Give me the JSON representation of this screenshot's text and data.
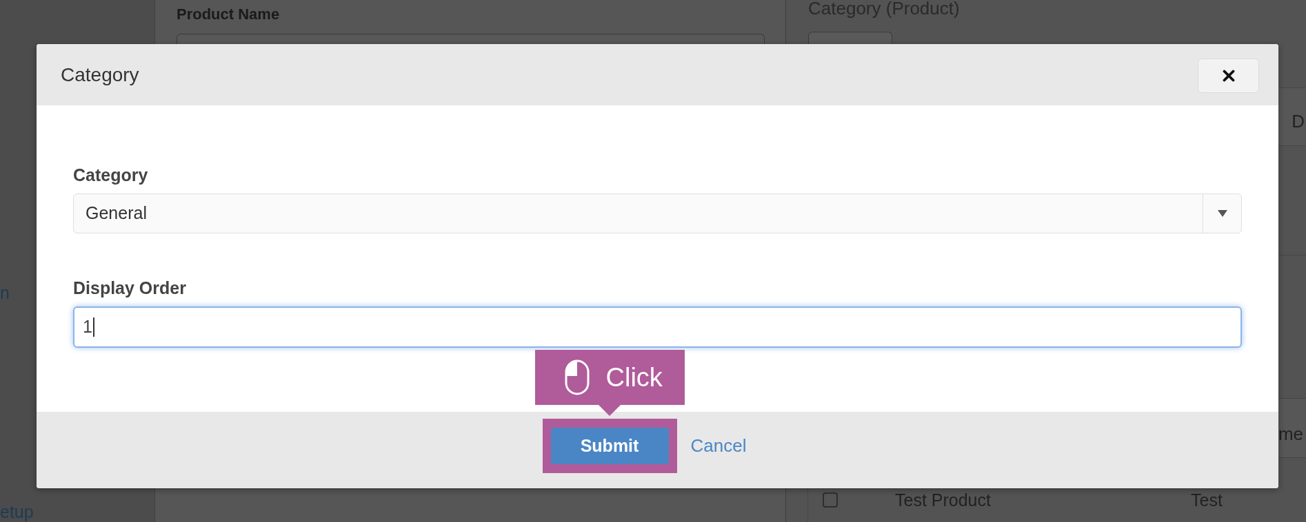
{
  "sidebar": {
    "links": [
      "n",
      "etup"
    ]
  },
  "product_form": {
    "label": "Product Name"
  },
  "category_panel": {
    "title": "Category (Product)",
    "table_1": {
      "columns": [
        "D"
      ]
    },
    "table_2": {
      "columns": [
        "me"
      ],
      "rows": [
        {
          "checked": false,
          "cells": [
            "Test Product",
            "Test"
          ]
        }
      ]
    }
  },
  "dialog": {
    "title": "Category",
    "fields": [
      {
        "kind": "select",
        "label": "Category",
        "value": "General"
      },
      {
        "kind": "text",
        "label": "Display Order",
        "value": "1",
        "focused": true
      }
    ],
    "buttons": [
      {
        "kind": "primary",
        "label": "Submit",
        "highlighted": true
      },
      {
        "kind": "link",
        "label": "Cancel",
        "highlighted": false
      }
    ]
  },
  "tutorial_tip": {
    "text": "Click"
  }
}
